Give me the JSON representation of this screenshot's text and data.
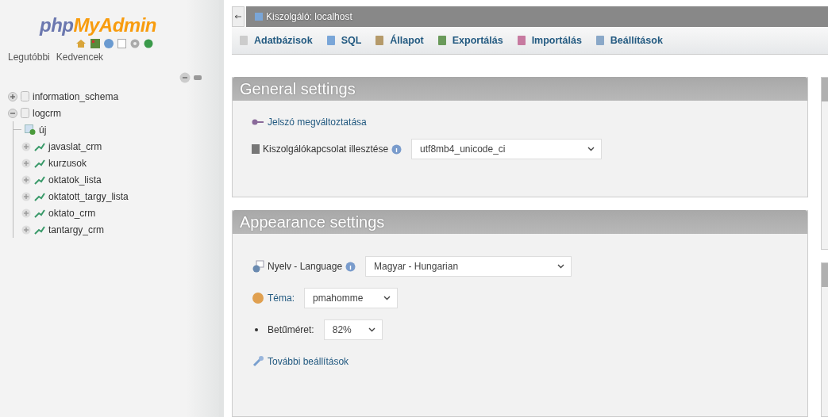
{
  "sidebar": {
    "logo": {
      "part1": "php",
      "part2": "MyAdmin"
    },
    "tabs": [
      "Legutóbbi",
      "Kedvencek"
    ],
    "tree": [
      {
        "label": "information_schema",
        "kind": "database",
        "expanded": false
      },
      {
        "label": "logcrm",
        "kind": "database",
        "expanded": true,
        "children": [
          {
            "label": "új",
            "kind": "new"
          },
          {
            "label": "javaslat_crm",
            "kind": "table",
            "expanded": false
          },
          {
            "label": "kurzusok",
            "kind": "table",
            "expanded": false
          },
          {
            "label": "oktatok_lista",
            "kind": "table",
            "expanded": false
          },
          {
            "label": "oktatott_targy_lista",
            "kind": "table",
            "expanded": false
          },
          {
            "label": "oktato_crm",
            "kind": "table",
            "expanded": false
          },
          {
            "label": "tantargy_crm",
            "kind": "table",
            "expanded": false
          }
        ]
      }
    ]
  },
  "server_bar": {
    "title": "Kiszolgáló: localhost"
  },
  "toolbar": [
    "Adatbázisok",
    "SQL",
    "Állapot",
    "Exportálás",
    "Importálás",
    "Beállítások"
  ],
  "panels": [
    {
      "title": "General settings",
      "items": [
        {
          "kind": "link",
          "label": "Jelszó megváltoztatása"
        },
        {
          "kind": "select",
          "label": "Kiszolgálókapcsolat illesztése",
          "help": true,
          "value": "utf8mb4_unicode_ci"
        }
      ]
    },
    {
      "title": "Appearance settings",
      "items": [
        {
          "kind": "select",
          "label": "Nyelv - Language",
          "help": true,
          "value": "Magyar - Hungarian"
        },
        {
          "kind": "link-select",
          "label": "Téma:",
          "help": false,
          "value": "pmahomme"
        },
        {
          "kind": "bullet-select",
          "label": "Betűméret:",
          "help": false,
          "value": "82%"
        },
        {
          "kind": "link",
          "label": "További beállítások"
        }
      ]
    }
  ]
}
